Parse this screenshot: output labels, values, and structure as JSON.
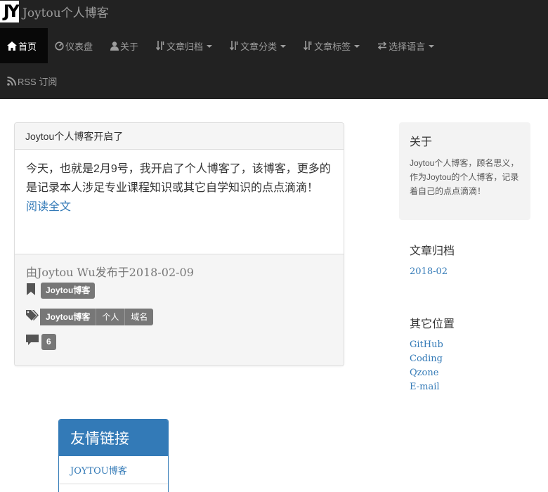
{
  "brand": {
    "logo_text": "JY",
    "title": "Joytou个人博客"
  },
  "nav": {
    "items": [
      {
        "label": "首页",
        "icon": "home-icon"
      },
      {
        "label": "仪表盘",
        "icon": "dashboard-icon"
      },
      {
        "label": "关于",
        "icon": "user-icon"
      },
      {
        "label": "文章归档",
        "icon": "sort-icon"
      },
      {
        "label": "文章分类",
        "icon": "sort-icon"
      },
      {
        "label": "文章标签",
        "icon": "sort-icon"
      },
      {
        "label": "选择语言",
        "icon": "transfer-icon"
      },
      {
        "label": "RSS 订阅",
        "icon": "rss-icon"
      }
    ],
    "active": "首页"
  },
  "post": {
    "title": "Joytou个人博客开启了",
    "excerpt": "今天，也就是2月9号，我开启了个人博客了，该博客，更多的是记录本人涉足专业课程知识或其它自学知识的点点滴滴！",
    "read_more": "阅读全文",
    "byline": "由Joytou Wu发布于2018-02-09",
    "category": "Joytou博客",
    "tags": [
      "Joytou博客",
      "个人",
      "域名"
    ],
    "comment_count": "6"
  },
  "sidebar": {
    "about": {
      "heading": "关于",
      "text": "Joytou个人博客，顾名思义，作为Joytou的个人博客，记录着自己的点点滴滴！"
    },
    "archive": {
      "heading": "文章归档",
      "items": [
        "2018-02"
      ]
    },
    "elsewhere": {
      "heading": "其它位置",
      "links": [
        "GitHub",
        "Coding",
        "Qzone",
        "E-mail"
      ]
    }
  },
  "friends": {
    "heading": "友情链接",
    "links": [
      "JOYTOU博客"
    ]
  },
  "colors": {
    "navbar": "#222222",
    "link": "#337ab7",
    "label": "#777777",
    "panel_head": "#f5f5f5"
  }
}
